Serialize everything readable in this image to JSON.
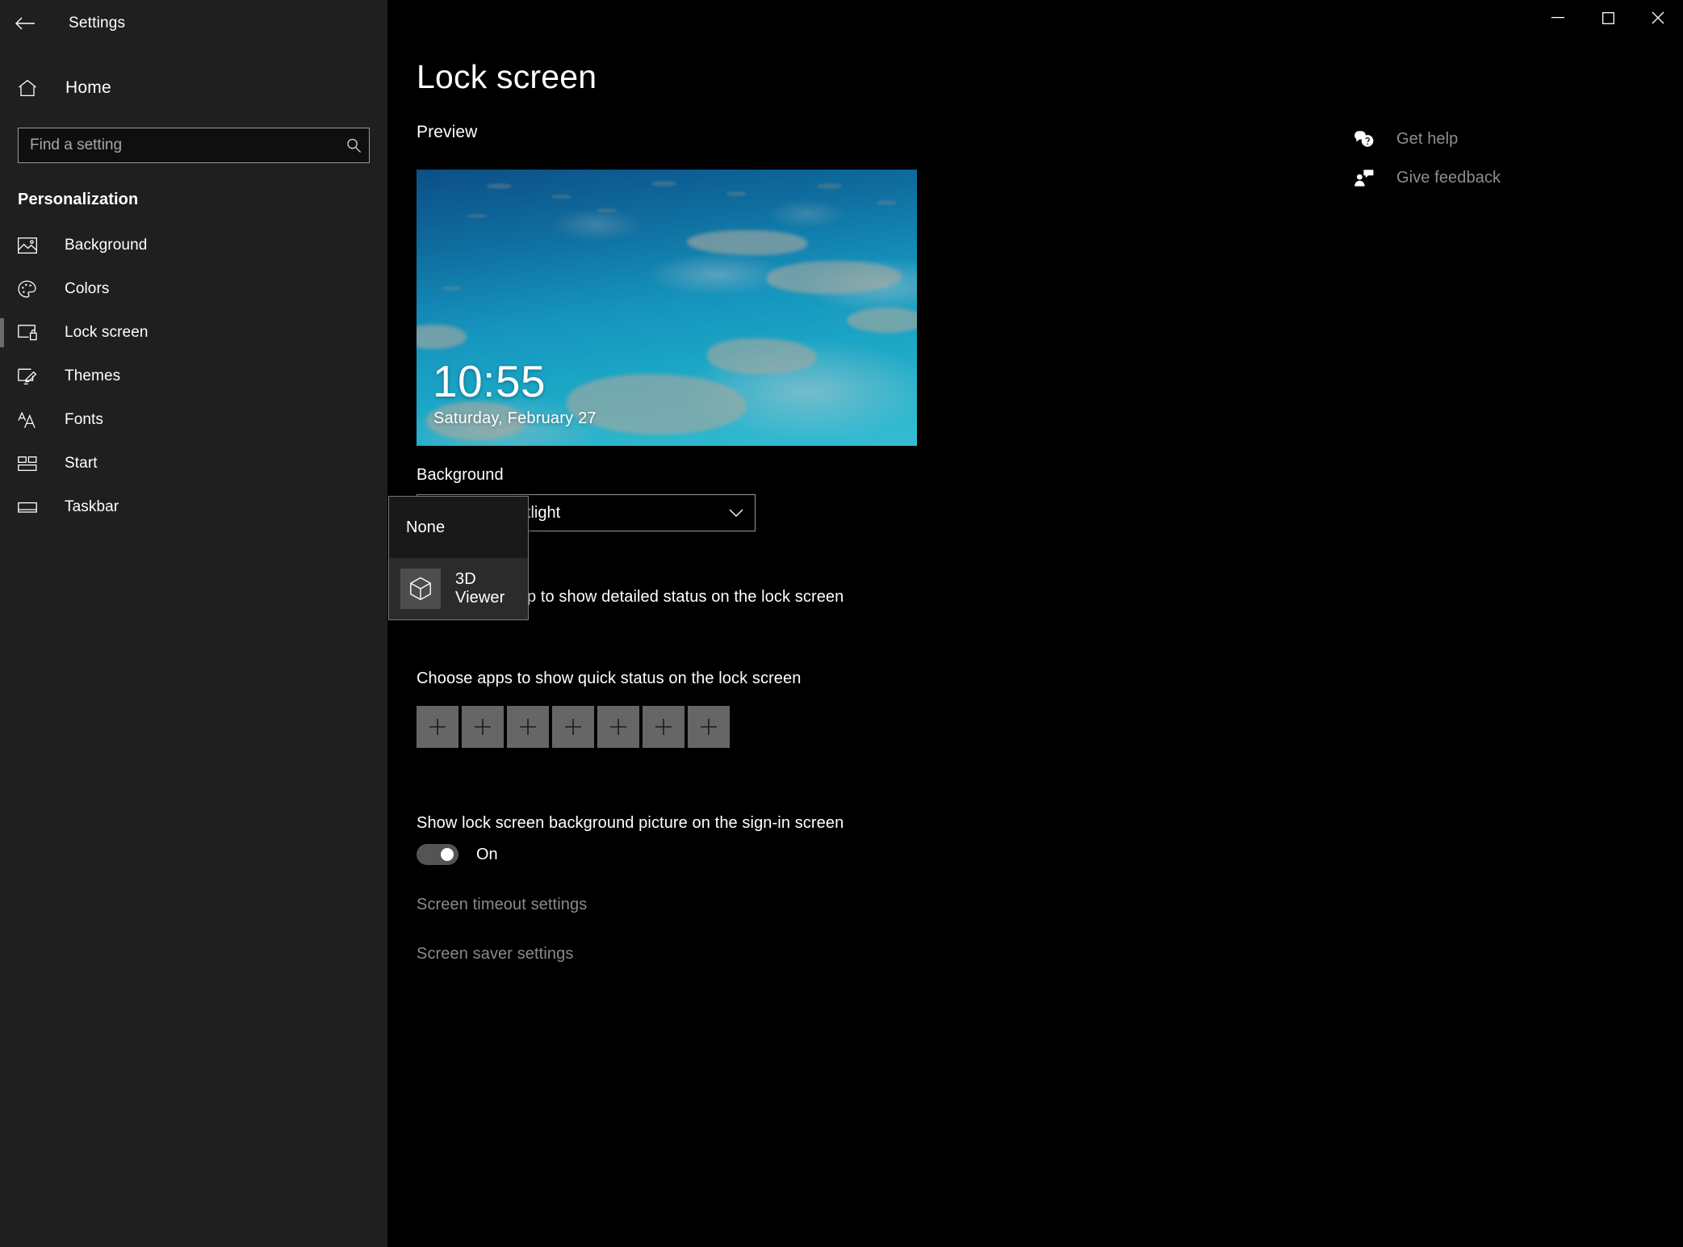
{
  "window": {
    "app_title": "Settings",
    "back_icon": "back-arrow-icon",
    "controls": {
      "minimize": "minimize-icon",
      "maximize": "maximize-icon",
      "close": "close-icon"
    }
  },
  "sidebar": {
    "home": {
      "label": "Home",
      "icon": "home-icon"
    },
    "search": {
      "placeholder": "Find a setting",
      "value": "",
      "icon": "search-icon"
    },
    "section_title": "Personalization",
    "items": [
      {
        "label": "Background",
        "icon": "picture-icon",
        "selected": false
      },
      {
        "label": "Colors",
        "icon": "palette-icon",
        "selected": false
      },
      {
        "label": "Lock screen",
        "icon": "lock-screen-icon",
        "selected": true
      },
      {
        "label": "Themes",
        "icon": "themes-brush-icon",
        "selected": false
      },
      {
        "label": "Fonts",
        "icon": "fonts-aa-icon",
        "selected": false
      },
      {
        "label": "Start",
        "icon": "start-tiles-icon",
        "selected": false
      },
      {
        "label": "Taskbar",
        "icon": "taskbar-icon",
        "selected": false
      }
    ]
  },
  "main": {
    "page_title": "Lock screen",
    "preview_heading": "Preview",
    "preview": {
      "clock": "10:55",
      "date": "Saturday, February 27"
    },
    "background_label": "Background",
    "background_value": "Windows spotlight",
    "background_chevron": "chevron-down-icon",
    "detailed_status_label": "Choose one app to show detailed status on the lock screen",
    "quick_status_label": "Choose apps to show quick status on the lock screen",
    "quick_status_tiles": [
      {
        "icon": "plus-icon"
      },
      {
        "icon": "plus-icon"
      },
      {
        "icon": "plus-icon"
      },
      {
        "icon": "plus-icon"
      },
      {
        "icon": "plus-icon"
      },
      {
        "icon": "plus-icon"
      },
      {
        "icon": "plus-icon"
      }
    ],
    "signin_label": "Show lock screen background picture on the sign-in screen",
    "signin_toggle_state": "On",
    "links": [
      {
        "label": "Screen timeout settings"
      },
      {
        "label": "Screen saver settings"
      }
    ]
  },
  "flyout": {
    "open": true,
    "options": [
      {
        "label": "None",
        "icon": null,
        "selected": true
      },
      {
        "label": "3D Viewer",
        "icon": "cube-3d-icon",
        "selected": false
      }
    ]
  },
  "help_panel": {
    "items": [
      {
        "label": "Get help",
        "icon": "help-bubble-icon"
      },
      {
        "label": "Give feedback",
        "icon": "feedback-person-icon"
      }
    ]
  },
  "colors": {
    "window_bg": "#000000",
    "sidebar_bg": "#1f1f1f",
    "text_primary": "#ffffff",
    "text_dim": "#8a8a8a",
    "tile_gray": "#666666",
    "flyout_bg": "#2b2b2b",
    "flyout_none_bg": "#191919",
    "border_gray": "#9a9a9a",
    "selection_bar": "#6b6b6b"
  }
}
